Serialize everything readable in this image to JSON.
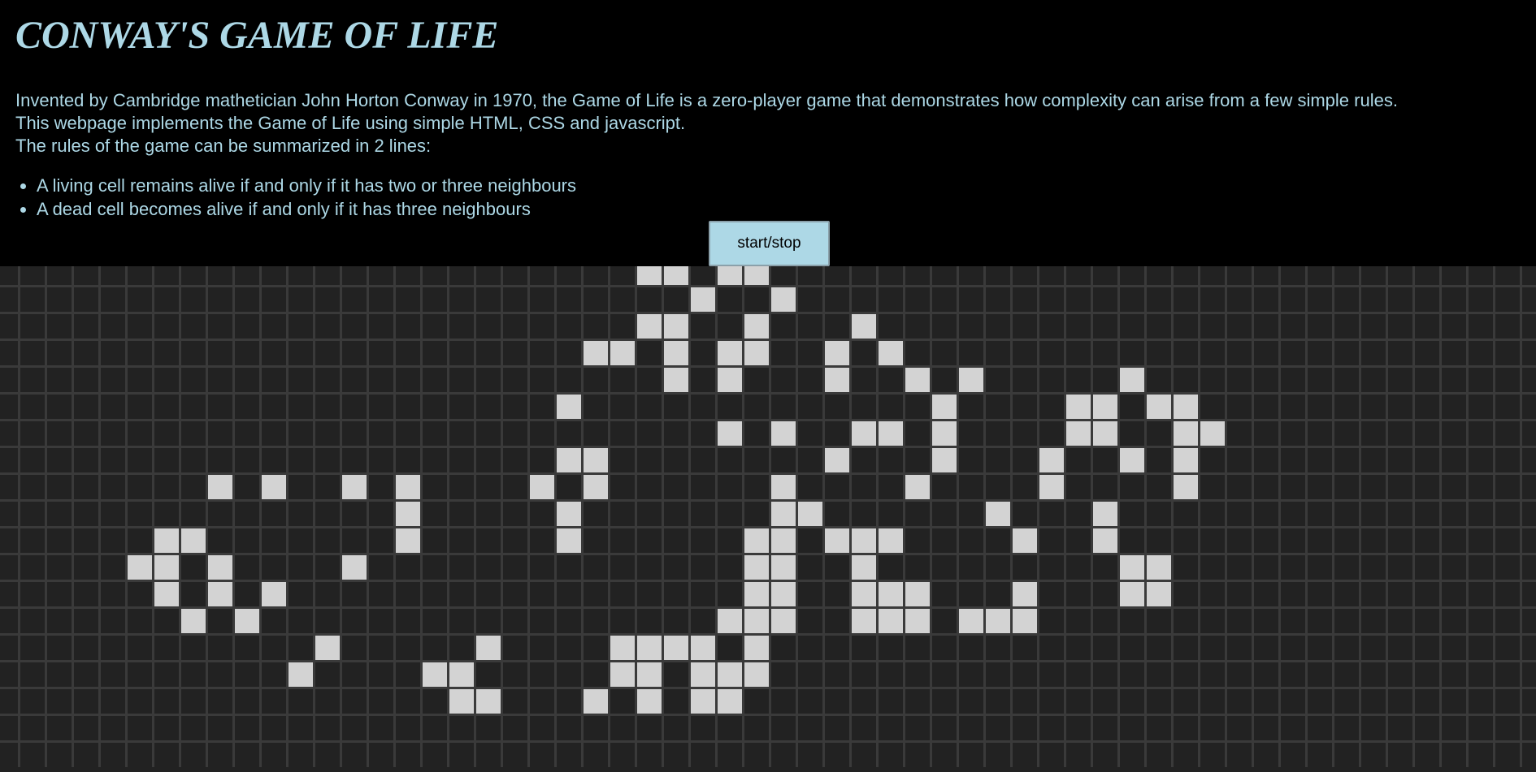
{
  "header": {
    "title": "CONWAY'S GAME OF LIFE",
    "intro_lines": [
      "Invented by Cambridge mathetician John Horton Conway in 1970, the Game of Life is a zero-player game that demonstrates how complexity can arise from a few simple rules.",
      "This webpage implements the Game of Life using simple HTML, CSS and javascript.",
      "The rules of the game can be summarized in 2 lines:"
    ],
    "rules": [
      "A living cell remains alive if and only if it has two or three neighbours",
      "A dead cell becomes alive if and only if it has three neighbours"
    ]
  },
  "controls": {
    "start_stop_label": "start/stop"
  },
  "colors": {
    "text": "#add8e6",
    "background": "#000000",
    "dead_cell": "#222222",
    "grid_line": "#3a3a3a",
    "alive_cell": "#d3d3d3",
    "button_bg": "#add8e6"
  },
  "board": {
    "columns": 58,
    "rows": 19,
    "alive_cells": [
      [
        24,
        0
      ],
      [
        25,
        0
      ],
      [
        27,
        0
      ],
      [
        28,
        0
      ],
      [
        26,
        1
      ],
      [
        29,
        1
      ],
      [
        24,
        2
      ],
      [
        25,
        2
      ],
      [
        28,
        2
      ],
      [
        32,
        2
      ],
      [
        22,
        3
      ],
      [
        23,
        3
      ],
      [
        25,
        3
      ],
      [
        27,
        3
      ],
      [
        28,
        3
      ],
      [
        31,
        3
      ],
      [
        33,
        3
      ],
      [
        25,
        4
      ],
      [
        27,
        4
      ],
      [
        31,
        4
      ],
      [
        34,
        4
      ],
      [
        36,
        4
      ],
      [
        42,
        4
      ],
      [
        21,
        5
      ],
      [
        35,
        5
      ],
      [
        40,
        5
      ],
      [
        41,
        5
      ],
      [
        43,
        5
      ],
      [
        44,
        5
      ],
      [
        27,
        6
      ],
      [
        29,
        6
      ],
      [
        32,
        6
      ],
      [
        33,
        6
      ],
      [
        35,
        6
      ],
      [
        40,
        6
      ],
      [
        41,
        6
      ],
      [
        44,
        6
      ],
      [
        45,
        6
      ],
      [
        21,
        7
      ],
      [
        22,
        7
      ],
      [
        31,
        7
      ],
      [
        35,
        7
      ],
      [
        39,
        7
      ],
      [
        42,
        7
      ],
      [
        44,
        7
      ],
      [
        8,
        8
      ],
      [
        10,
        8
      ],
      [
        13,
        8
      ],
      [
        15,
        8
      ],
      [
        20,
        8
      ],
      [
        22,
        8
      ],
      [
        29,
        8
      ],
      [
        34,
        8
      ],
      [
        39,
        8
      ],
      [
        44,
        8
      ],
      [
        15,
        9
      ],
      [
        21,
        9
      ],
      [
        29,
        9
      ],
      [
        30,
        9
      ],
      [
        37,
        9
      ],
      [
        41,
        9
      ],
      [
        6,
        10
      ],
      [
        7,
        10
      ],
      [
        15,
        10
      ],
      [
        21,
        10
      ],
      [
        28,
        10
      ],
      [
        29,
        10
      ],
      [
        31,
        10
      ],
      [
        32,
        10
      ],
      [
        33,
        10
      ],
      [
        38,
        10
      ],
      [
        41,
        10
      ],
      [
        5,
        11
      ],
      [
        6,
        11
      ],
      [
        8,
        11
      ],
      [
        13,
        11
      ],
      [
        28,
        11
      ],
      [
        29,
        11
      ],
      [
        32,
        11
      ],
      [
        42,
        11
      ],
      [
        43,
        11
      ],
      [
        6,
        12
      ],
      [
        8,
        12
      ],
      [
        10,
        12
      ],
      [
        28,
        12
      ],
      [
        29,
        12
      ],
      [
        32,
        12
      ],
      [
        33,
        12
      ],
      [
        34,
        12
      ],
      [
        38,
        12
      ],
      [
        42,
        12
      ],
      [
        43,
        12
      ],
      [
        7,
        13
      ],
      [
        9,
        13
      ],
      [
        27,
        13
      ],
      [
        28,
        13
      ],
      [
        29,
        13
      ],
      [
        32,
        13
      ],
      [
        33,
        13
      ],
      [
        34,
        13
      ],
      [
        36,
        13
      ],
      [
        37,
        13
      ],
      [
        38,
        13
      ],
      [
        12,
        14
      ],
      [
        18,
        14
      ],
      [
        23,
        14
      ],
      [
        24,
        14
      ],
      [
        25,
        14
      ],
      [
        26,
        14
      ],
      [
        28,
        14
      ],
      [
        11,
        15
      ],
      [
        16,
        15
      ],
      [
        17,
        15
      ],
      [
        23,
        15
      ],
      [
        24,
        15
      ],
      [
        26,
        15
      ],
      [
        27,
        15
      ],
      [
        28,
        15
      ],
      [
        17,
        16
      ],
      [
        18,
        16
      ],
      [
        22,
        16
      ],
      [
        24,
        16
      ],
      [
        26,
        16
      ],
      [
        27,
        16
      ]
    ]
  }
}
